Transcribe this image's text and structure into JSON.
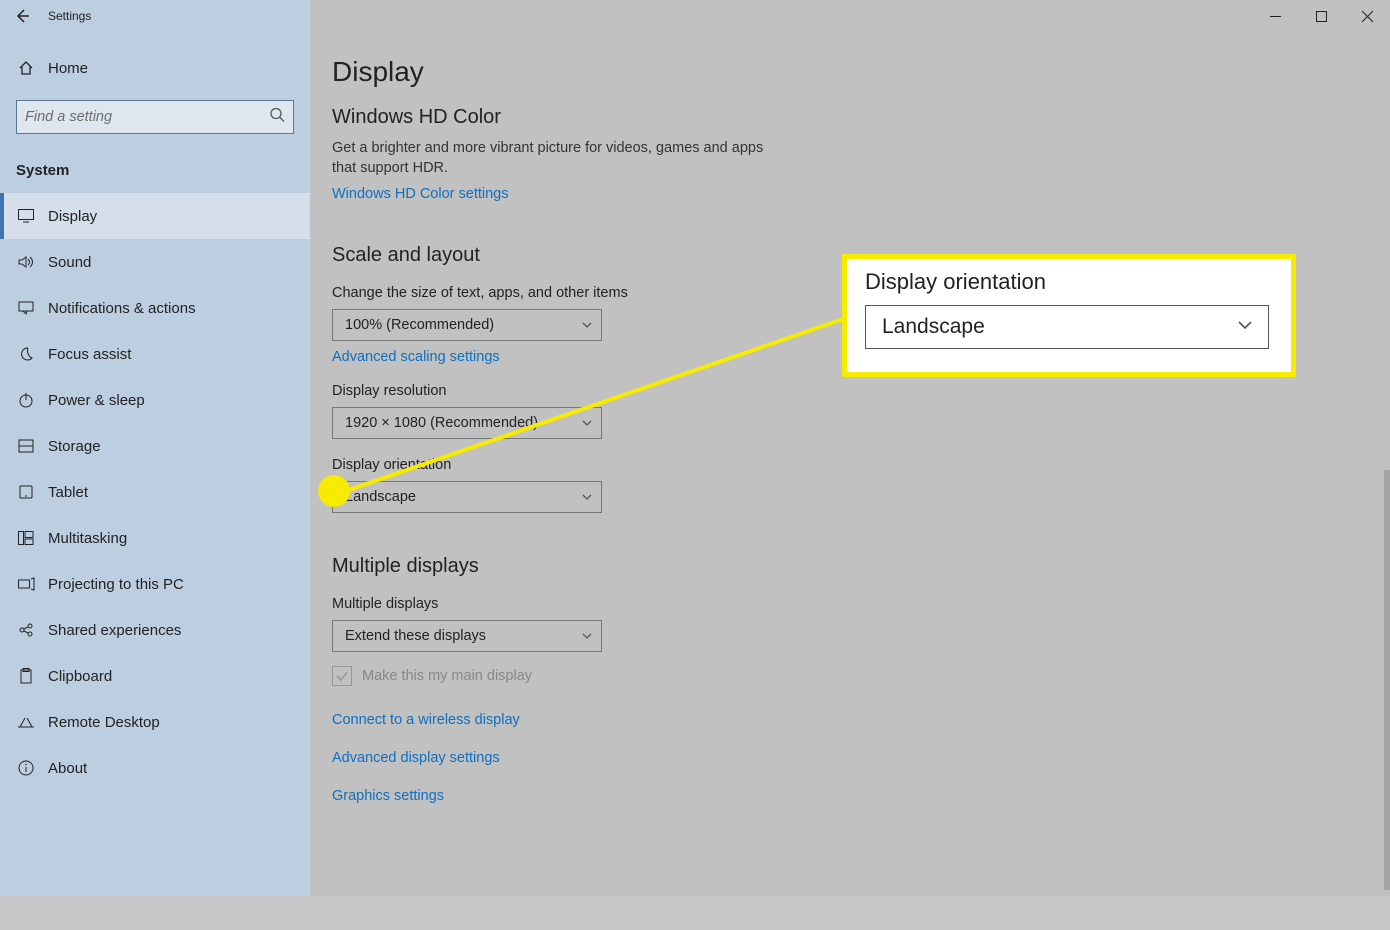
{
  "window": {
    "title": "Settings",
    "min": "Minimize",
    "max": "Maximize",
    "close": "Close"
  },
  "sidebar": {
    "home_label": "Home",
    "search_placeholder": "Find a setting",
    "section_label": "System",
    "items": [
      {
        "label": "Display",
        "icon": "display-icon",
        "active": true
      },
      {
        "label": "Sound",
        "icon": "sound-icon"
      },
      {
        "label": "Notifications & actions",
        "icon": "notifications-icon"
      },
      {
        "label": "Focus assist",
        "icon": "moon-icon"
      },
      {
        "label": "Power & sleep",
        "icon": "power-icon"
      },
      {
        "label": "Storage",
        "icon": "storage-icon"
      },
      {
        "label": "Tablet",
        "icon": "tablet-icon"
      },
      {
        "label": "Multitasking",
        "icon": "multitasking-icon"
      },
      {
        "label": "Projecting to this PC",
        "icon": "projecting-icon"
      },
      {
        "label": "Shared experiences",
        "icon": "shared-icon"
      },
      {
        "label": "Clipboard",
        "icon": "clipboard-icon"
      },
      {
        "label": "Remote Desktop",
        "icon": "remote-icon"
      },
      {
        "label": "About",
        "icon": "about-icon"
      }
    ]
  },
  "page": {
    "title": "Display",
    "hd_color": {
      "title": "Windows HD Color",
      "desc": "Get a brighter and more vibrant picture for videos, games and apps that support HDR.",
      "link": "Windows HD Color settings"
    },
    "scale": {
      "title": "Scale and layout",
      "size_label": "Change the size of text, apps, and other items",
      "size_value": "100% (Recommended)",
      "adv_scaling_link": "Advanced scaling settings",
      "res_label": "Display resolution",
      "res_value": "1920 × 1080 (Recommended)",
      "orient_label": "Display orientation",
      "orient_value": "Landscape"
    },
    "multi": {
      "title": "Multiple displays",
      "label": "Multiple displays",
      "value": "Extend these displays",
      "checkbox_label": "Make this my main display",
      "link_wireless": "Connect to a wireless display",
      "link_advanced": "Advanced display settings",
      "link_graphics": "Graphics settings"
    }
  },
  "callout": {
    "title": "Display orientation",
    "value": "Landscape"
  }
}
